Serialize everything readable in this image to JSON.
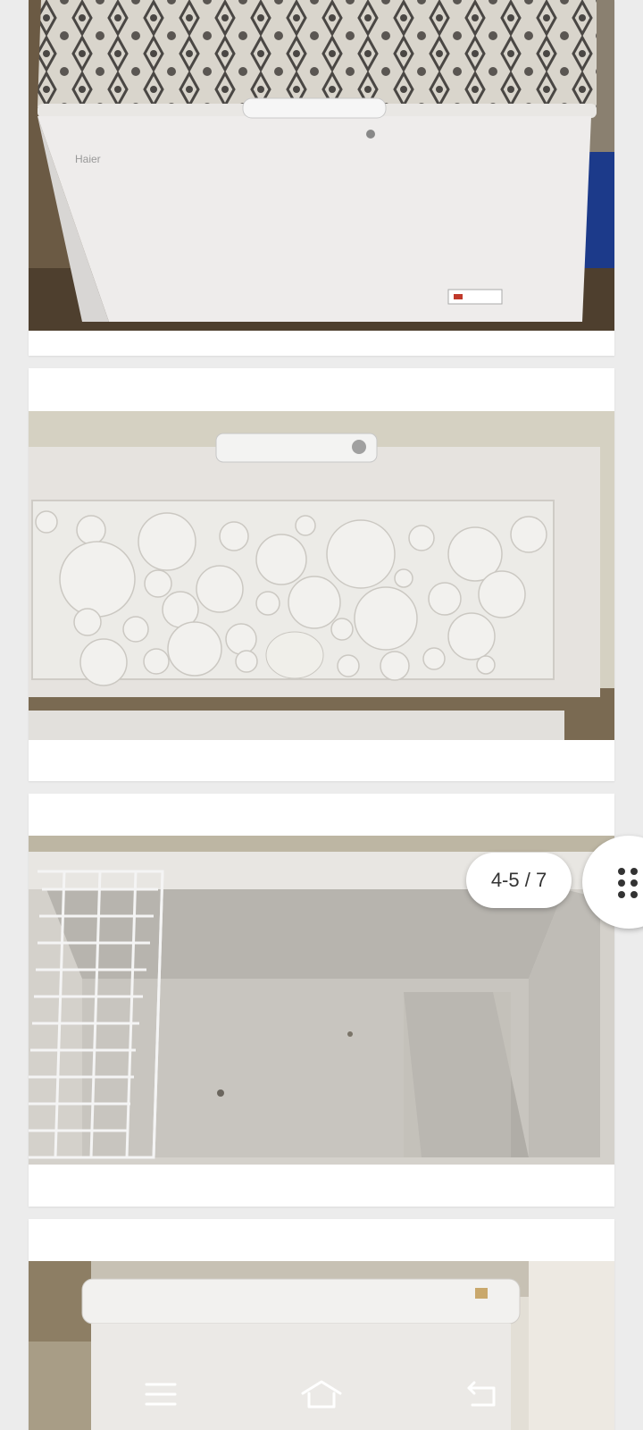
{
  "gallery": {
    "counter": "4-5 / 7",
    "photos": [
      {
        "subject": "chest-freezer-front-closed"
      },
      {
        "subject": "chest-freezer-lid-inside"
      },
      {
        "subject": "chest-freezer-interior-basket"
      },
      {
        "subject": "chest-freezer-front-partial"
      }
    ],
    "brand_mark": "Haier"
  },
  "controls": {
    "grid_icon": "grid-dots-icon"
  },
  "navbar": {
    "menu_icon": "menu-icon",
    "home_icon": "home-icon",
    "back_icon": "back-icon"
  },
  "colors": {
    "page_bg": "#ececec",
    "card_bg": "#ffffff",
    "text": "#333333"
  }
}
